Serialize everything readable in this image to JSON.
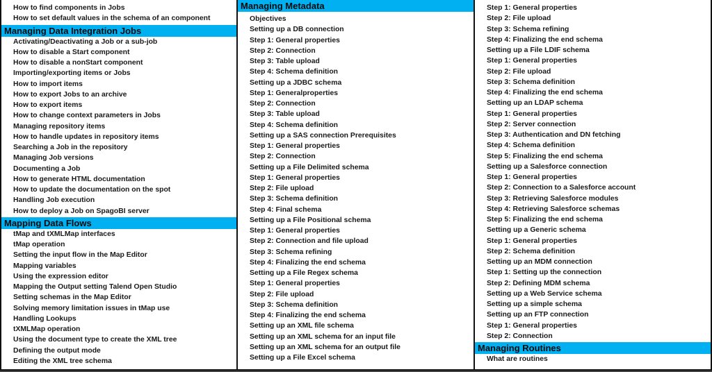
{
  "columns": [
    {
      "items": [
        {
          "type": "item",
          "text": "How to find components in Jobs"
        },
        {
          "type": "item",
          "text": "How to set default values in the schema of an component"
        },
        {
          "type": "header",
          "text": "Managing Data Integration Jobs"
        },
        {
          "type": "item",
          "text": "Activating/Deactivating a Job or a sub-job"
        },
        {
          "type": "item",
          "text": "How to disable a Start component"
        },
        {
          "type": "item",
          "text": "How to disable a nonStart component"
        },
        {
          "type": "item",
          "text": "Importing/exporting items or Jobs"
        },
        {
          "type": "item",
          "text": "How to import items"
        },
        {
          "type": "item",
          "text": "How to export Jobs to an archive"
        },
        {
          "type": "item",
          "text": "How to export items"
        },
        {
          "type": "item",
          "text": "How to change context parameters in Jobs"
        },
        {
          "type": "item",
          "text": "Managing repository items"
        },
        {
          "type": "item",
          "text": "How to handle updates in repository items"
        },
        {
          "type": "item",
          "text": "Searching a Job in the repository"
        },
        {
          "type": "item",
          "text": "Managing Job versions"
        },
        {
          "type": "item",
          "text": "Documenting a Job"
        },
        {
          "type": "item",
          "text": "How to generate HTML documentation"
        },
        {
          "type": "item",
          "text": "How to update the documentation on the spot"
        },
        {
          "type": "item",
          "text": "Handling Job execution"
        },
        {
          "type": "item",
          "text": "How to deploy a Job on SpagoBI server"
        },
        {
          "type": "header",
          "text": "Mapping Data Flows"
        },
        {
          "type": "item",
          "text": "tMap and tXMLMap interfaces"
        },
        {
          "type": "item",
          "text": "tMap operation"
        },
        {
          "type": "item",
          "text": "Setting the input flow in the Map Editor"
        },
        {
          "type": "item",
          "text": "Mapping variables"
        },
        {
          "type": "item",
          "text": "Using the expression editor"
        },
        {
          "type": "item",
          "text": "Mapping the Output setting Talend Open Studio"
        },
        {
          "type": "item",
          "text": "Setting schemas in the Map Editor"
        },
        {
          "type": "item",
          "text": "Solving memory limitation issues in tMap use"
        },
        {
          "type": "item",
          "text": "Handling Lookups"
        },
        {
          "type": "item",
          "text": "tXMLMap operation"
        },
        {
          "type": "item",
          "text": "Using the document type to create the XML tree"
        },
        {
          "type": "item",
          "text": "Defining the output mode"
        },
        {
          "type": "item",
          "text": "Editing the XML tree schema"
        }
      ]
    },
    {
      "items": [
        {
          "type": "header",
          "text": "Managing Metadata"
        },
        {
          "type": "item",
          "text": "Objectives"
        },
        {
          "type": "item",
          "text": "Setting up a DB connection"
        },
        {
          "type": "item",
          "text": "Step 1: General properties"
        },
        {
          "type": "item",
          "text": "Step 2: Connection"
        },
        {
          "type": "item",
          "text": "Step 3: Table upload"
        },
        {
          "type": "item",
          "text": "Step 4: Schema definition"
        },
        {
          "type": "item",
          "text": "Setting up a JDBC schema"
        },
        {
          "type": "item",
          "text": "Step 1: Generalproperties"
        },
        {
          "type": "item",
          "text": "Step 2: Connection"
        },
        {
          "type": "item",
          "text": "Step 3: Table upload"
        },
        {
          "type": "item",
          "text": "Step 4: Schema definition"
        },
        {
          "type": "item",
          "text": "Setting up a SAS connection  Prerequisites"
        },
        {
          "type": "item",
          "text": "Step 1: General properties"
        },
        {
          "type": "item",
          "text": "Step 2: Connection"
        },
        {
          "type": "item",
          "text": "Setting up a File Delimited schema"
        },
        {
          "type": "item",
          "text": "Step 1: General properties"
        },
        {
          "type": "item",
          "text": "Step 2: File upload"
        },
        {
          "type": "item",
          "text": "Step 3: Schema definition"
        },
        {
          "type": "item",
          "text": "Step 4: Final schema"
        },
        {
          "type": "item",
          "text": "Setting up a File Positional schema"
        },
        {
          "type": "item",
          "text": "Step 1: General properties"
        },
        {
          "type": "item",
          "text": "Step 2: Connection and file upload"
        },
        {
          "type": "item",
          "text": "Step 3: Schema refining"
        },
        {
          "type": "item",
          "text": "Step 4: Finalizing the end schema"
        },
        {
          "type": "item",
          "text": "Setting up a File Regex schema"
        },
        {
          "type": "item",
          "text": "Step 1: General properties"
        },
        {
          "type": "item",
          "text": "Step 2: File upload"
        },
        {
          "type": "item",
          "text": "Step 3: Schema definition"
        },
        {
          "type": "item",
          "text": "Step 4: Finalizing the end schema"
        },
        {
          "type": "item",
          "text": "Setting up an XML file schema"
        },
        {
          "type": "item",
          "text": "Setting up an XML schema for an input file"
        },
        {
          "type": "item",
          "text": "Setting up an XML schema for an output file"
        },
        {
          "type": "item",
          "text": "Setting up a File Excel schema"
        }
      ]
    },
    {
      "items": [
        {
          "type": "item",
          "text": "Step 1: General properties"
        },
        {
          "type": "item",
          "text": "Step 2: File upload"
        },
        {
          "type": "item",
          "text": "Step 3: Schema refining"
        },
        {
          "type": "item",
          "text": "Step 4: Finalizing the end schema"
        },
        {
          "type": "item",
          "text": "Setting up a File LDIF schema"
        },
        {
          "type": "item",
          "text": "Step 1: General properties"
        },
        {
          "type": "item",
          "text": "Step 2: File upload"
        },
        {
          "type": "item",
          "text": "Step 3: Schema definition"
        },
        {
          "type": "item",
          "text": "Step 4: Finalizing the end schema"
        },
        {
          "type": "item",
          "text": "Setting up an LDAP schema"
        },
        {
          "type": "item",
          "text": "Step 1: General properties"
        },
        {
          "type": "item",
          "text": "Step 2: Server connection"
        },
        {
          "type": "item",
          "text": "Step 3: Authentication and DN fetching"
        },
        {
          "type": "item",
          "text": "Step 4: Schema definition"
        },
        {
          "type": "item",
          "text": "Step 5: Finalizing the end schema"
        },
        {
          "type": "item",
          "text": "Setting up a Salesforce connection"
        },
        {
          "type": "item",
          "text": "Step 1: General properties"
        },
        {
          "type": "item",
          "text": "Step 2: Connection to a Salesforce account"
        },
        {
          "type": "item",
          "text": "Step 3: Retrieving Salesforce modules"
        },
        {
          "type": "item",
          "text": "Step 4: Retrieving Salesforce schemas"
        },
        {
          "type": "item",
          "text": "Step 5: Finalizing the end schema"
        },
        {
          "type": "item",
          "text": "Setting up a Generic schema"
        },
        {
          "type": "item",
          "text": "Step 1: General properties"
        },
        {
          "type": "item",
          "text": "Step 2: Schema definition"
        },
        {
          "type": "item",
          "text": "Setting up an MDM connection"
        },
        {
          "type": "item",
          "text": "Step 1: Setting up the connection"
        },
        {
          "type": "item",
          "text": "Step 2: Defining MDM schema"
        },
        {
          "type": "item",
          "text": "Setting up a Web Service schema"
        },
        {
          "type": "item",
          "text": "Setting up a simple schema"
        },
        {
          "type": "item",
          "text": "Setting up an FTP connection"
        },
        {
          "type": "item",
          "text": "Step 1: General properties"
        },
        {
          "type": "item",
          "text": "Step 2: Connection"
        },
        {
          "type": "header",
          "text": "Managing Routines"
        },
        {
          "type": "item",
          "text": "What are routines"
        }
      ]
    }
  ],
  "colors": {
    "header_background": "#00b0f0",
    "text": "#1a1a1a"
  }
}
